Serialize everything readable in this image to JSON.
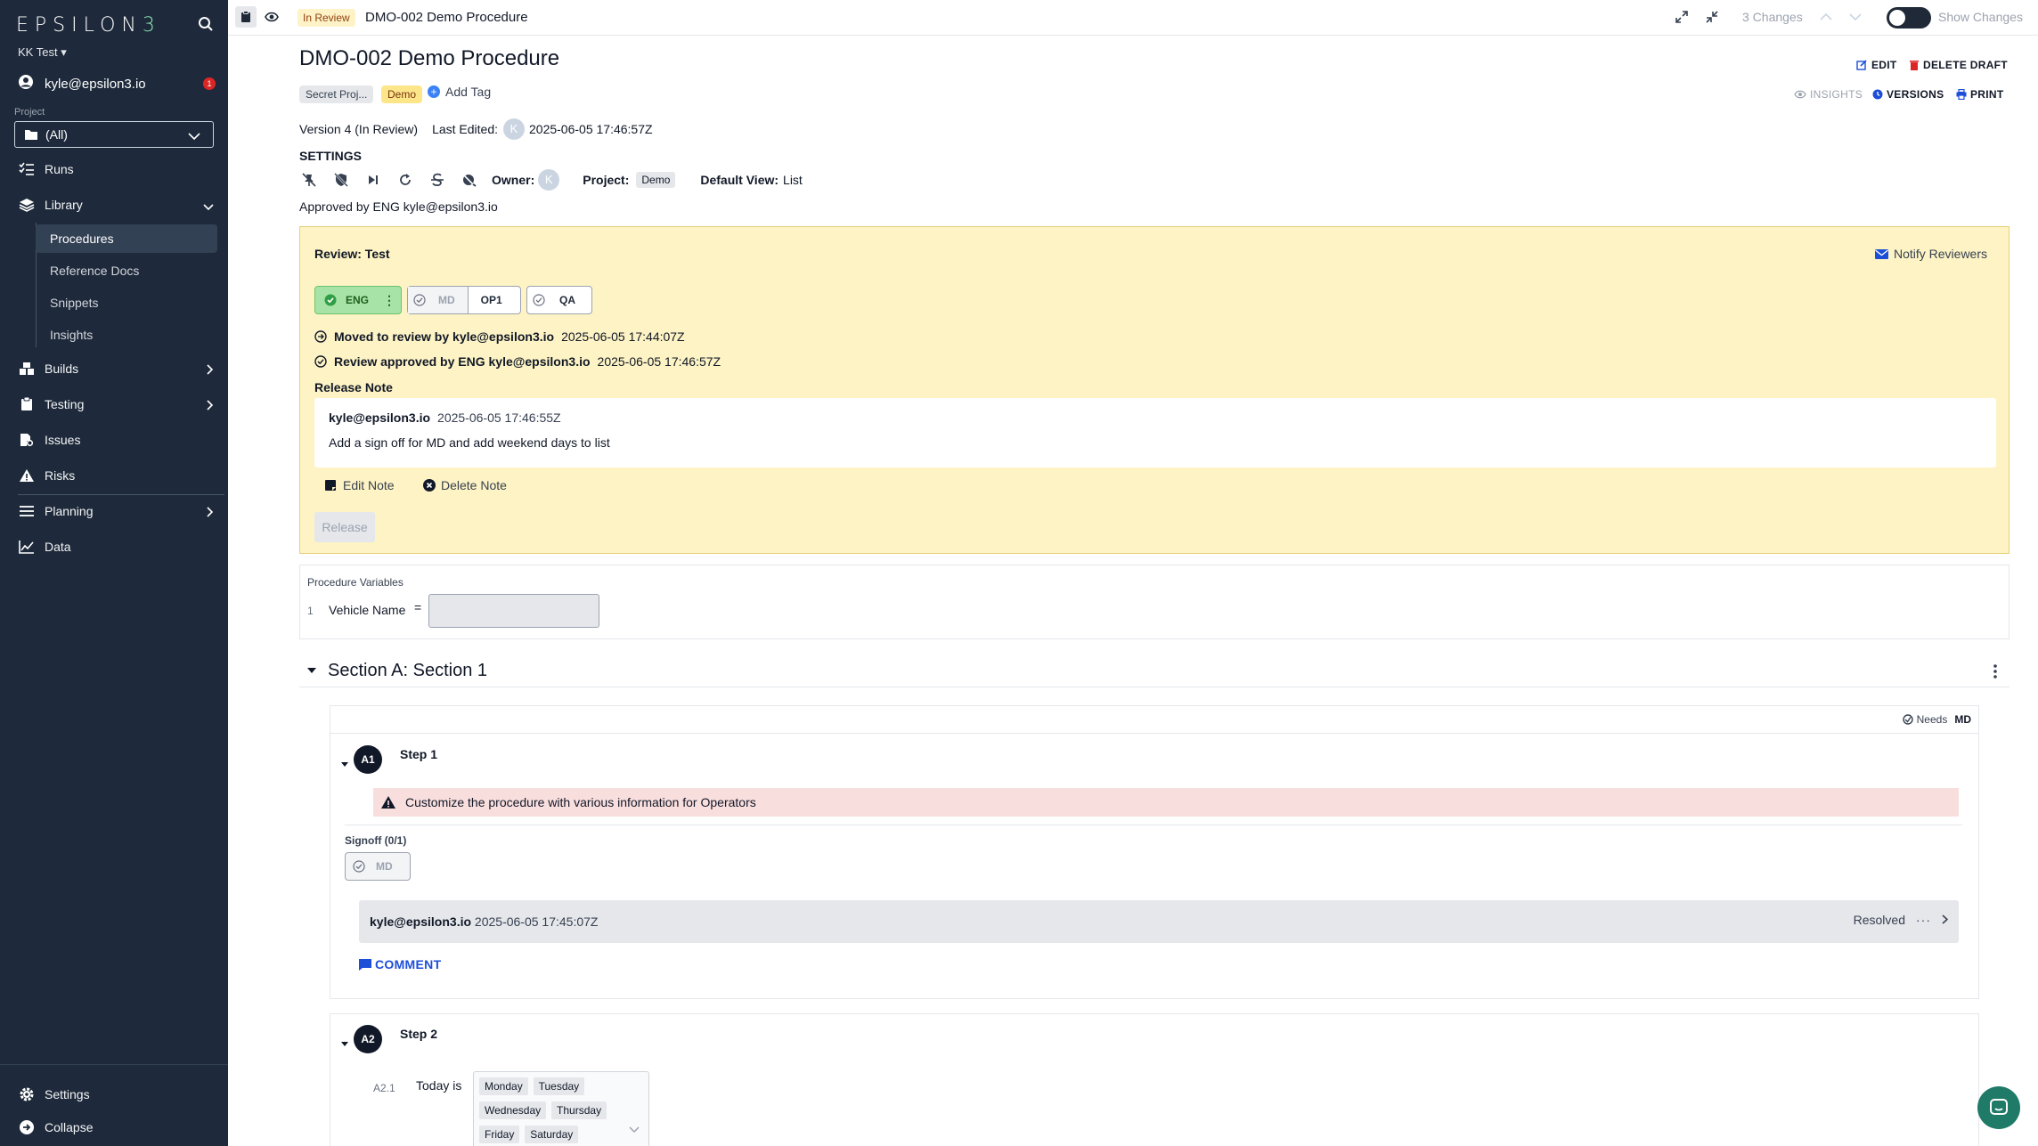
{
  "sidebar": {
    "logo_main": "EPSILON",
    "logo_last": "3",
    "team": "KK Test",
    "user": "kyle@epsilon3.io",
    "notif_count": "1",
    "project_label": "Project",
    "project_value": "(All)",
    "nav": {
      "runs": "Runs",
      "library": "Library",
      "builds": "Builds",
      "testing": "Testing",
      "issues": "Issues",
      "risks": "Risks",
      "planning": "Planning",
      "data": "Data",
      "settings": "Settings",
      "collapse": "Collapse"
    },
    "library_items": [
      "Procedures",
      "Reference Docs",
      "Snippets",
      "Insights"
    ]
  },
  "topbar": {
    "status": "In Review",
    "title": "DMO-002 Demo Procedure",
    "changes": "3 Changes",
    "show_changes": "Show Changes"
  },
  "procedure": {
    "title": "DMO-002 Demo Procedure",
    "tags": [
      "Secret Proj...",
      "Demo"
    ],
    "add_tag": "Add Tag",
    "edit": "EDIT",
    "delete_draft": "DELETE DRAFT",
    "insights": "INSIGHTS",
    "versions": "VERSIONS",
    "print": "PRINT",
    "version": "Version 4 (In Review)",
    "last_edited_label": "Last Edited:",
    "last_edited": "2025-06-05 17:46:57Z",
    "avatar_initial": "K",
    "settings_label": "SETTINGS",
    "owner_label": "Owner:",
    "project_label": "Project:",
    "project_tag": "Demo",
    "default_view_label": "Default View:",
    "default_view": "List",
    "approved": "Approved by ENG kyle@epsilon3.io"
  },
  "review": {
    "title": "Review: Test",
    "notify": "Notify Reviewers",
    "chips": {
      "eng": "ENG",
      "md": "MD",
      "op1": "OP1",
      "qa": "QA"
    },
    "events": [
      {
        "text": "Moved to review by kyle@epsilon3.io",
        "ts": "2025-06-05 17:44:07Z"
      },
      {
        "text": "Review approved by ENG kyle@epsilon3.io",
        "ts": "2025-06-05 17:46:57Z"
      }
    ],
    "release_note_label": "Release Note",
    "note_author": "kyle@epsilon3.io",
    "note_ts": "2025-06-05 17:46:55Z",
    "note_text": "Add a sign off for MD and add weekend days to list",
    "edit_note": "Edit Note",
    "delete_note": "Delete Note",
    "release": "Release"
  },
  "variables": {
    "header": "Procedure Variables",
    "index": "1",
    "name": "Vehicle Name",
    "eq": "=",
    "value": ""
  },
  "section": {
    "title": "Section A: Section 1"
  },
  "step1": {
    "num": "A1",
    "title": "Step 1",
    "needs_label": "Needs",
    "needs_role": "MD",
    "warning": "Customize the procedure with various information for Operators",
    "signoff_label": "Signoff (0/1)",
    "signoff_role": "MD",
    "comment_author": "kyle@epsilon3.io",
    "comment_ts": "2025-06-05 17:45:07Z",
    "resolved": "Resolved",
    "comment_btn": "COMMENT"
  },
  "step2": {
    "num": "A2",
    "title": "Step 2",
    "sub_num": "A2.1",
    "sub_label": "Today is",
    "days": [
      "Monday",
      "Tuesday",
      "Wednesday",
      "Thursday",
      "Friday",
      "Saturday"
    ]
  }
}
